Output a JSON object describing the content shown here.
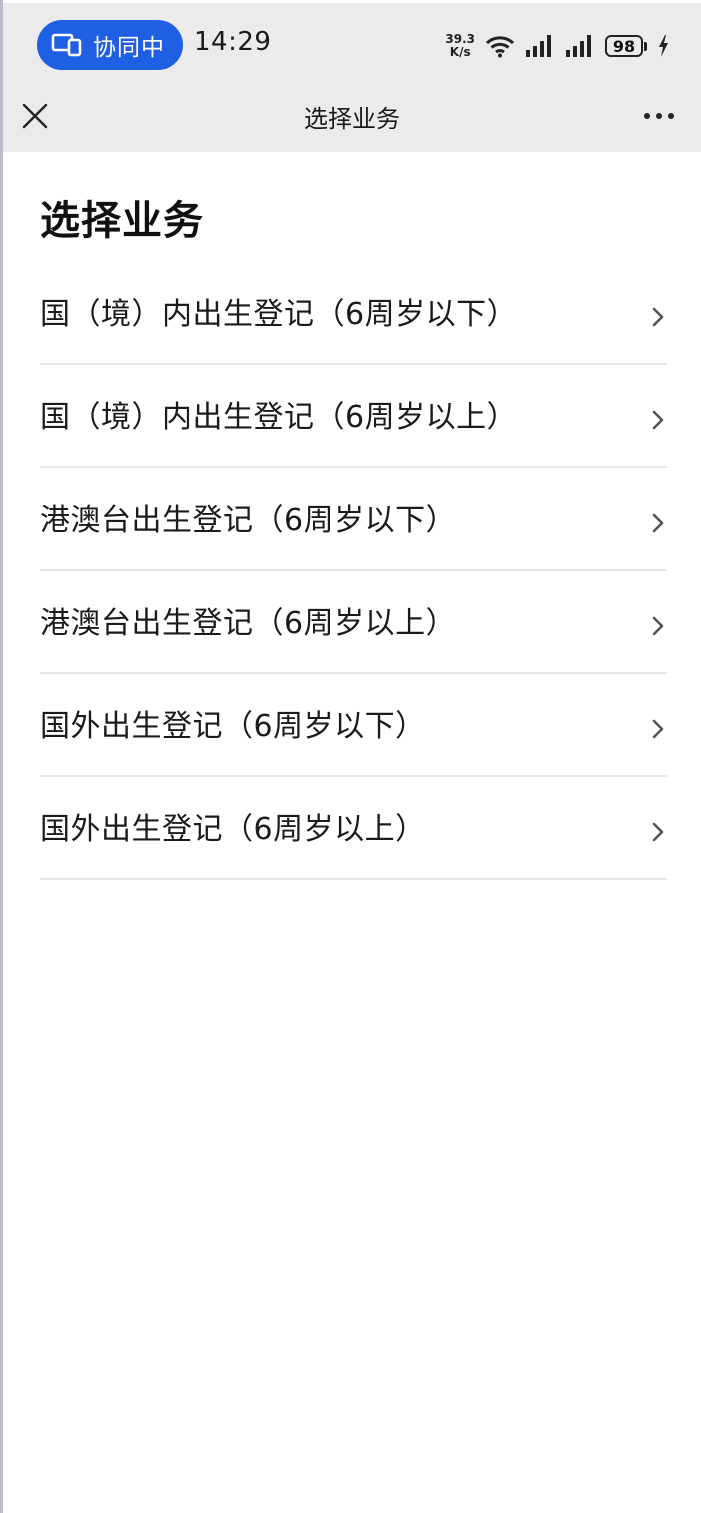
{
  "status_bar": {
    "collab_label": "协同中",
    "time": "14:29",
    "net_speed_value": "39.3",
    "net_speed_unit": "K/s",
    "battery_level": "98"
  },
  "nav": {
    "title": "选择业务"
  },
  "page": {
    "heading": "选择业务"
  },
  "services": [
    {
      "label": "国（境）内出生登记（6周岁以下）"
    },
    {
      "label": "国（境）内出生登记（6周岁以上）"
    },
    {
      "label": "港澳台出生登记（6周岁以下）"
    },
    {
      "label": "港澳台出生登记（6周岁以上）"
    },
    {
      "label": "国外出生登记（6周岁以下）"
    },
    {
      "label": "国外出生登记（6周岁以上）"
    }
  ],
  "icons": {
    "collab": "devices-icon",
    "wifi": "wifi-icon",
    "signal": "signal-icon",
    "battery": "battery-icon",
    "charging": "charging-bolt-icon",
    "close": "close-icon",
    "more": "more-icon",
    "chevron": "chevron-right-icon"
  },
  "colors": {
    "collab_pill": "#1f5fe3",
    "header_bg": "#ebebeb",
    "divider": "#e6e6e6"
  }
}
